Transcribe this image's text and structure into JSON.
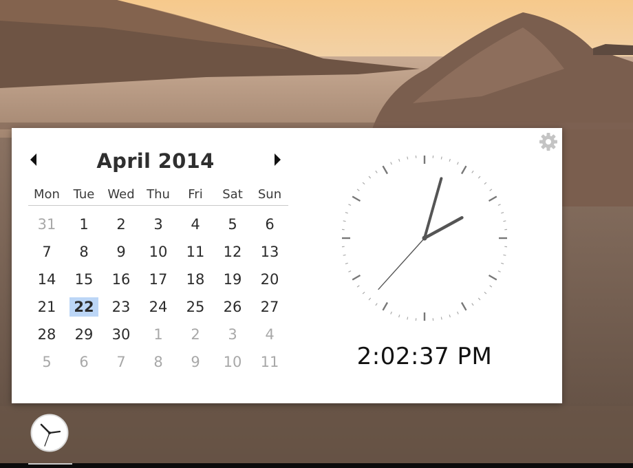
{
  "calendar": {
    "title": "April 2014",
    "prev_icon": "left-triangle-icon",
    "next_icon": "right-triangle-icon",
    "weekdays": [
      "Mon",
      "Tue",
      "Wed",
      "Thu",
      "Fri",
      "Sat",
      "Sun"
    ],
    "days": [
      {
        "label": "31",
        "muted": true
      },
      {
        "label": "1"
      },
      {
        "label": "2"
      },
      {
        "label": "3"
      },
      {
        "label": "4"
      },
      {
        "label": "5"
      },
      {
        "label": "6"
      },
      {
        "label": "7"
      },
      {
        "label": "8"
      },
      {
        "label": "9"
      },
      {
        "label": "10"
      },
      {
        "label": "11"
      },
      {
        "label": "12"
      },
      {
        "label": "13"
      },
      {
        "label": "14"
      },
      {
        "label": "15"
      },
      {
        "label": "16"
      },
      {
        "label": "17"
      },
      {
        "label": "18"
      },
      {
        "label": "19"
      },
      {
        "label": "20"
      },
      {
        "label": "21"
      },
      {
        "label": "22",
        "today": true
      },
      {
        "label": "23"
      },
      {
        "label": "24"
      },
      {
        "label": "25"
      },
      {
        "label": "26"
      },
      {
        "label": "27"
      },
      {
        "label": "28"
      },
      {
        "label": "29"
      },
      {
        "label": "30"
      },
      {
        "label": "1",
        "muted": true
      },
      {
        "label": "2",
        "muted": true
      },
      {
        "label": "3",
        "muted": true
      },
      {
        "label": "4",
        "muted": true
      },
      {
        "label": "5",
        "muted": true
      },
      {
        "label": "6",
        "muted": true
      },
      {
        "label": "7",
        "muted": true
      },
      {
        "label": "8",
        "muted": true
      },
      {
        "label": "9",
        "muted": true
      },
      {
        "label": "10",
        "muted": true
      },
      {
        "label": "11",
        "muted": true
      }
    ],
    "highlight_color": "#bcd6f6"
  },
  "clock": {
    "time_text": "2:02:37 PM",
    "hours": 2,
    "minutes": 2,
    "seconds": 37
  },
  "settings_icon": "gear-icon",
  "taskbar": {
    "clock_icon": "clock-icon"
  }
}
